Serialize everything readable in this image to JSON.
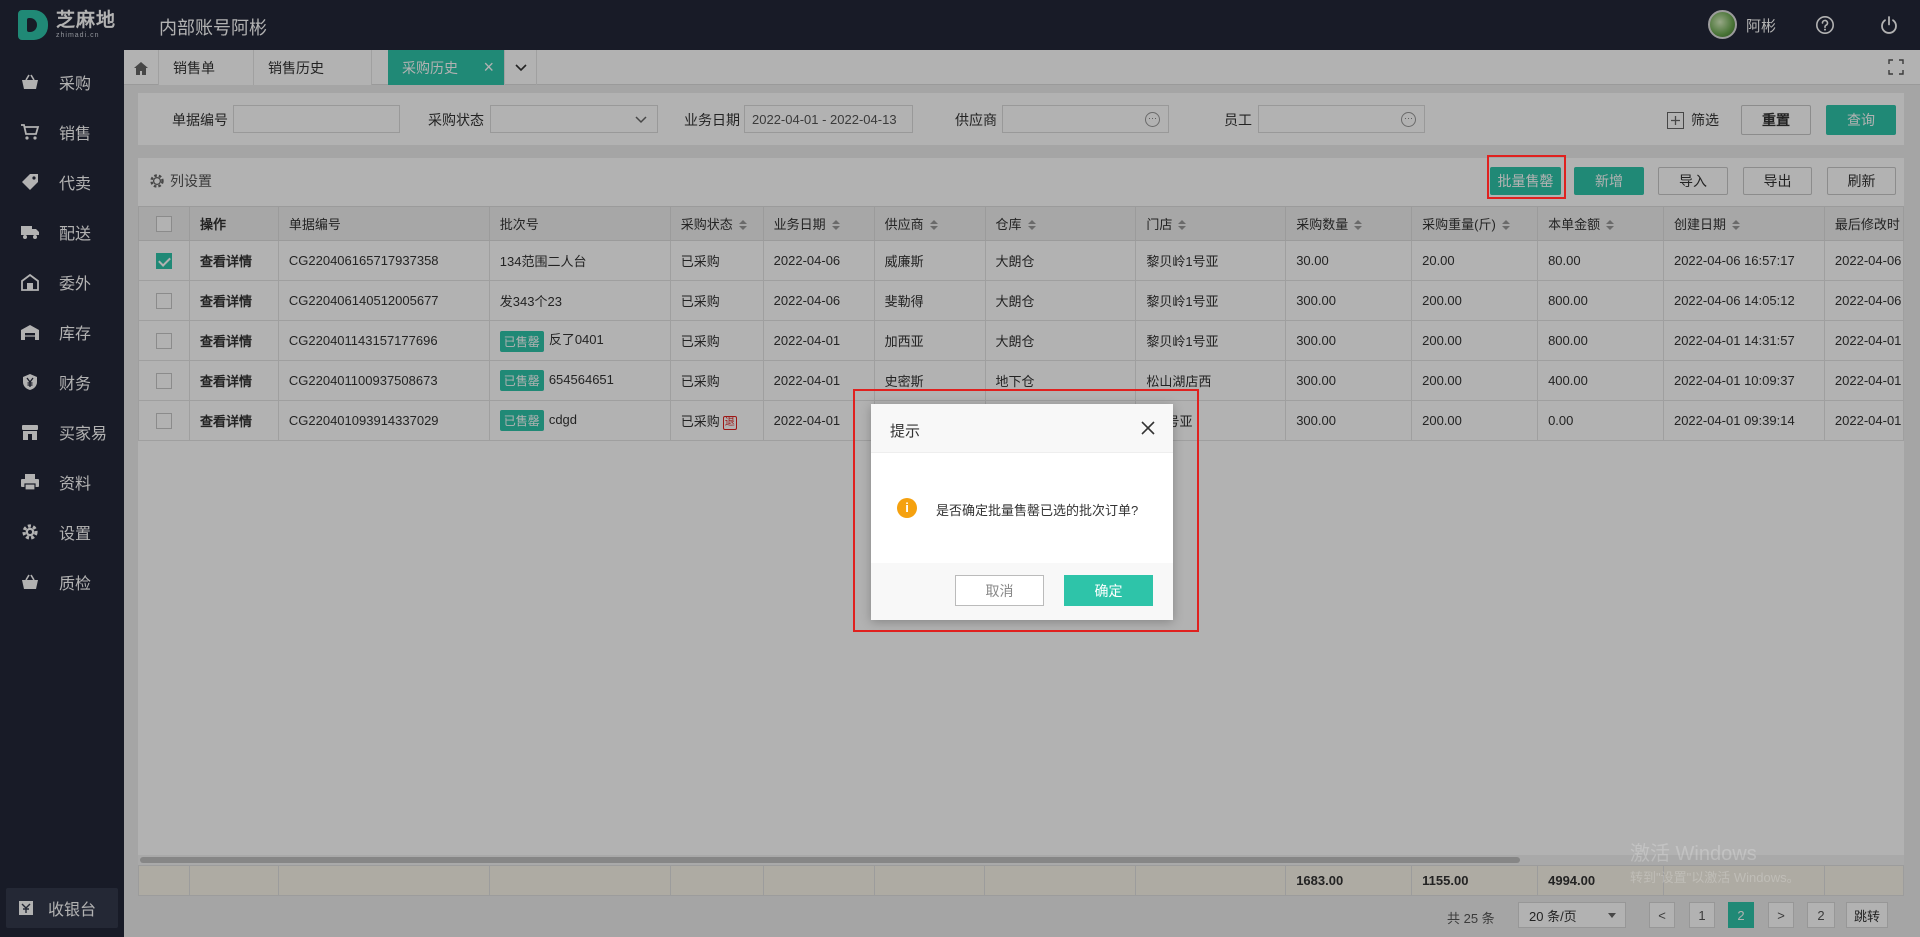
{
  "app": {
    "logo_cn": "芝麻地",
    "logo_en": "zhimadi.cn",
    "title": "内部账号阿彬",
    "user_name": "阿彬"
  },
  "sidebar": {
    "items": [
      {
        "label": "采购",
        "icon": "basket-icon"
      },
      {
        "label": "销售",
        "icon": "cart-icon"
      },
      {
        "label": "代卖",
        "icon": "tag-icon"
      },
      {
        "label": "配送",
        "icon": "truck-icon"
      },
      {
        "label": "委外",
        "icon": "outsource-icon"
      },
      {
        "label": "库存",
        "icon": "warehouse-icon"
      },
      {
        "label": "财务",
        "icon": "yen-icon"
      },
      {
        "label": "买家易",
        "icon": "shop-icon"
      },
      {
        "label": "资料",
        "icon": "printer-icon"
      },
      {
        "label": "设置",
        "icon": "gear-icon"
      },
      {
        "label": "质检",
        "icon": "basket-icon"
      }
    ],
    "cashier_label": "收银台"
  },
  "tabs": [
    {
      "label": "销售单"
    },
    {
      "label": "销售历史"
    },
    {
      "label": "采购历史",
      "active": true
    }
  ],
  "filters": {
    "doc_no_label": "单据编号",
    "doc_no_value": "",
    "status_label": "采购状态",
    "status_value": "",
    "date_label": "业务日期",
    "date_value": "2022-04-01 - 2022-04-13",
    "supplier_label": "供应商",
    "supplier_value": "",
    "staff_label": "员工",
    "staff_value": "",
    "filter_label": "筛选",
    "reset_label": "重置",
    "query_label": "查询"
  },
  "toolbar": {
    "column_settings_label": "列设置",
    "batch_sellout_label": "批量售罄",
    "add_label": "新增",
    "import_label": "导入",
    "export_label": "导出",
    "refresh_label": "刷新"
  },
  "table": {
    "columns": [
      "操作",
      "单据编号",
      "批次号",
      "采购状态",
      "业务日期",
      "供应商",
      "仓库",
      "门店",
      "采购数量",
      "采购重量(斤)",
      "本单金额",
      "创建日期",
      "最后修改时"
    ],
    "rows": [
      {
        "checked": true,
        "action": "查看详情",
        "doc_no": "CG220406165717937358",
        "sold_badge": "",
        "batch": "134范围二人台",
        "status": "已采购",
        "status_tag": "",
        "date": "2022-04-06",
        "supplier": "威廉斯",
        "warehouse": "大朗仓",
        "store": "黎贝岭1号亚",
        "qty": "30.00",
        "weight": "20.00",
        "amount": "80.00",
        "created": "2022-04-06 16:57:17",
        "modified": "2022-04-06"
      },
      {
        "checked": false,
        "action": "查看详情",
        "doc_no": "CG220406140512005677",
        "sold_badge": "",
        "batch": "发343个23",
        "status": "已采购",
        "status_tag": "",
        "date": "2022-04-06",
        "supplier": "斐勒得",
        "warehouse": "大朗仓",
        "store": "黎贝岭1号亚",
        "qty": "300.00",
        "weight": "200.00",
        "amount": "800.00",
        "created": "2022-04-06 14:05:12",
        "modified": "2022-04-06"
      },
      {
        "checked": false,
        "action": "查看详情",
        "doc_no": "CG220401143157177696",
        "sold_badge": "已售罄",
        "batch": "反了0401",
        "status": "已采购",
        "status_tag": "",
        "date": "2022-04-01",
        "supplier": "加西亚",
        "warehouse": "大朗仓",
        "store": "黎贝岭1号亚",
        "qty": "300.00",
        "weight": "200.00",
        "amount": "800.00",
        "created": "2022-04-01 14:31:57",
        "modified": "2022-04-01"
      },
      {
        "checked": false,
        "action": "查看详情",
        "doc_no": "CG220401100937508673",
        "sold_badge": "已售罄",
        "batch": "654564651",
        "status": "已采购",
        "status_tag": "",
        "date": "2022-04-01",
        "supplier": "史密斯",
        "warehouse": "地下仓",
        "store": "松山湖店西",
        "qty": "300.00",
        "weight": "200.00",
        "amount": "400.00",
        "created": "2022-04-01 10:09:37",
        "modified": "2022-04-01"
      },
      {
        "checked": false,
        "action": "查看详情",
        "doc_no": "CG220401093914337029",
        "sold_badge": "已售罄",
        "batch": "cdgd",
        "status": "已采购",
        "status_tag": "退",
        "date": "2022-04-01",
        "supplier": "",
        "warehouse": "",
        "store": "岭1号亚",
        "qty": "300.00",
        "weight": "200.00",
        "amount": "0.00",
        "created": "2022-04-01 09:39:14",
        "modified": "2022-04-01"
      }
    ],
    "totals": {
      "qty": "1683.00",
      "weight": "1155.00",
      "amount": "4994.00"
    }
  },
  "pagination": {
    "total_text": "共 25 条",
    "page_size": "20 条/页",
    "prev": "<",
    "pages": [
      "1",
      "2"
    ],
    "current": "2",
    "next": ">",
    "goto_value": "2",
    "jump_label": "跳转"
  },
  "dialog": {
    "title": "提示",
    "message": "是否确定批量售罄已选的批次订单?",
    "cancel_label": "取消",
    "ok_label": "确定",
    "icon": "warning-icon"
  },
  "watermark": {
    "line1": "激活 Windows",
    "line2": "转到\"设置\"以激活 Windows。"
  },
  "colors": {
    "accent": "#2ec4a9",
    "nav_bg": "#232738",
    "highlight_border": "#e0211f",
    "warning": "#f5a10f"
  }
}
